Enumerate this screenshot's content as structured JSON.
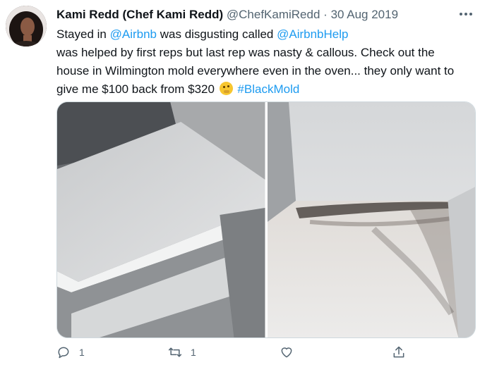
{
  "tweet": {
    "author_name": "Kami Redd (Chef Kami Redd)",
    "handle": "@ChefKamiRedd",
    "separator": "·",
    "date": "30 Aug 2019",
    "text": {
      "line1_prefix": "Stayed in ",
      "mention1": "@Airbnb",
      "line1_middle": " was disgusting called ",
      "mention2": "@AirbnbHelp",
      "line2": " was helped by first reps but last rep was nasty & callous. Check out the",
      "line3": "house in Wilmington mold everywhere even in the oven... they only want to",
      "line4_prefix": "give me $100 back from $320 ",
      "hashtag": "#BlackMold"
    }
  },
  "media": {
    "photos": [
      {
        "subject": "white cabinet shelves"
      },
      {
        "subject": "shelf with black mold"
      }
    ]
  },
  "actions": {
    "reply_count": "1",
    "retweet_count": "1",
    "like_count": "",
    "icons": [
      "reply-icon",
      "retweet-icon",
      "like-icon",
      "share-icon"
    ]
  }
}
